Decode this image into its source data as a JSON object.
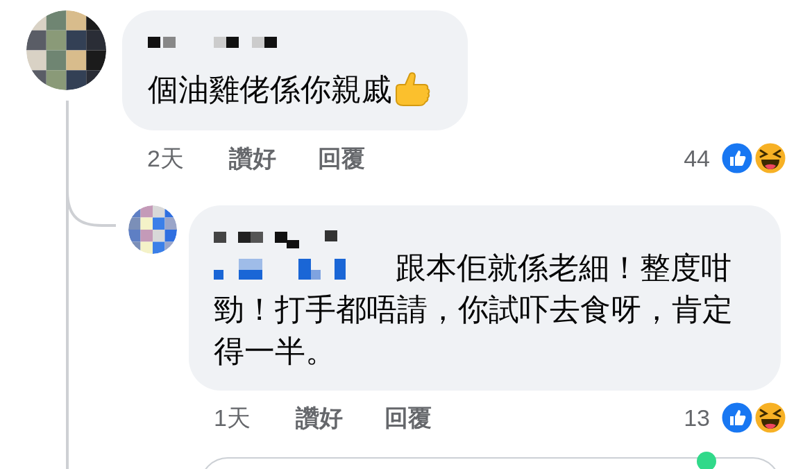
{
  "comment": {
    "text": "個油雞佬係你親戚",
    "thumbs_up_emoji": true,
    "time": "2天",
    "like_label": "讚好",
    "reply_label": "回覆",
    "reaction_count": "44",
    "reactions": [
      {
        "kind": "like"
      },
      {
        "kind": "haha"
      }
    ],
    "replies": [
      {
        "mention": true,
        "text": "跟本佢就係老細！整度咁勁！打手都唔請，你試吓去食呀，肯定得一半。",
        "time": "1天",
        "like_label": "讚好",
        "reply_label": "回覆",
        "reaction_count": "13",
        "reactions": [
          {
            "kind": "like"
          },
          {
            "kind": "haha"
          }
        ]
      }
    ]
  }
}
